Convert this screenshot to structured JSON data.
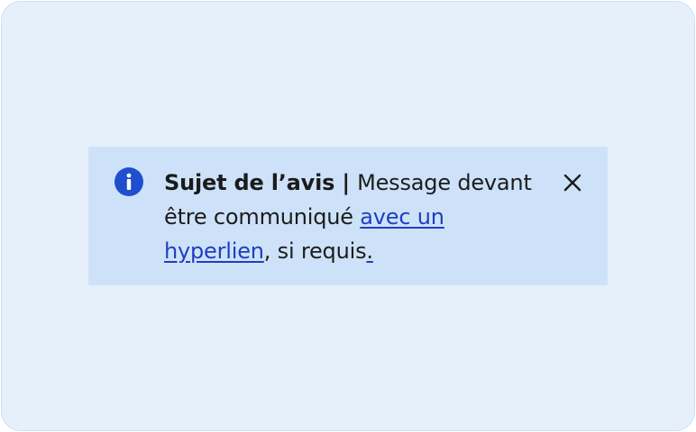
{
  "notice": {
    "heading": "Sujet de l’avis",
    "separator": " | ",
    "message_start": "Message devant être communiqué ",
    "link_text": "avec un hyperlien",
    "message_end": ", si requis",
    "period": ".",
    "close_icon": "close-icon",
    "info_icon": "info-icon"
  },
  "colors": {
    "page_background": "#e6f0fb",
    "notice_background": "#cde2f8",
    "icon_blue": "#1f4fcf",
    "link": "#1f3ec1",
    "text": "#1c1c1c"
  }
}
